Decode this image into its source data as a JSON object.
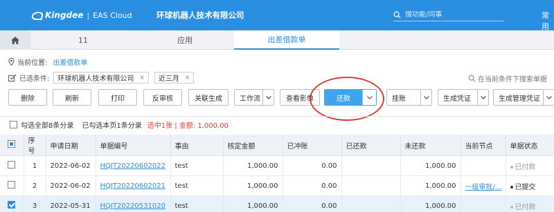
{
  "header": {
    "brand": "Kingdee",
    "product": "EAS Cloud",
    "company": "环球机器人技术有限公司",
    "search_placeholder": "搜功能/同事",
    "right_text": "常用"
  },
  "tabs": [
    {
      "label": "11"
    },
    {
      "label": "应用"
    },
    {
      "label": "出差借款单"
    }
  ],
  "location": {
    "label": "当前位置:",
    "value": "出差借款单"
  },
  "filters": {
    "label": "已选条件:",
    "chips": [
      "环球机器人技术有限公司",
      "近三月"
    ],
    "hint": "在当前条件下搜索单据"
  },
  "toolbar": {
    "delete": "删除",
    "refresh": "刷新",
    "print": "打印",
    "unaudit": "反审核",
    "related_gen": "关联生成",
    "workflow": "工作流",
    "view_image": "查看影像",
    "repay": "还款",
    "hang": "挂账",
    "gen_voucher": "生成凭证",
    "gen_mgmt_voucher": "生成管理凭证"
  },
  "selection": {
    "select_all": "勾选全部8条分录",
    "checked_page": "已勾选本页1条分录",
    "summary": "选中1张 | 金额: 1,000.00"
  },
  "table": {
    "columns": [
      "序号",
      "申请日期",
      "单据编号",
      "事由",
      "核定金额",
      "已冲账",
      "已还款",
      "未还款",
      "当前节点",
      "单据状态"
    ],
    "rows": [
      {
        "checked": false,
        "seq": "1",
        "date": "2022-06-02",
        "no": "HQJT20220602022",
        "reason": "test",
        "approved": "1,000.00",
        "offset": "0.00",
        "repaid": "",
        "unpaid": "1,000.00",
        "node": "",
        "status": "已付款",
        "status_dark": false
      },
      {
        "checked": false,
        "seq": "2",
        "date": "2022-06-02",
        "no": "HQJT20220602021",
        "reason": "test",
        "approved": "1,000.00",
        "offset": "0.00",
        "repaid": "",
        "unpaid": "1,000.00",
        "node": "一级审批/...",
        "status": "已提交",
        "status_dark": true
      },
      {
        "checked": true,
        "seq": "3",
        "date": "2022-05-31",
        "no": "HQJT20220531020",
        "reason": "test",
        "approved": "1,000.00",
        "offset": "0.00",
        "repaid": "",
        "unpaid": "1,000.00",
        "node": "",
        "status": "已付款",
        "status_dark": false
      }
    ]
  },
  "colors": {
    "primary": "#2a8fe0",
    "button_active": "#3fa6ee",
    "highlight": "#e03c31"
  }
}
